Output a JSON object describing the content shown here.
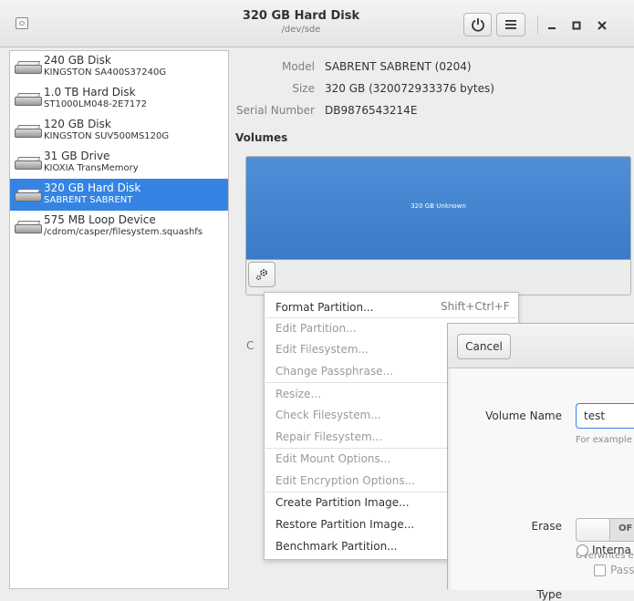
{
  "header": {
    "title": "320 GB Hard Disk",
    "subtitle": "/dev/sde"
  },
  "disks": [
    {
      "name": "240 GB Disk",
      "model": "KINGSTON SA400S37240G",
      "selected": false
    },
    {
      "name": "1.0 TB Hard Disk",
      "model": "ST1000LM048-2E7172",
      "selected": false
    },
    {
      "name": "120 GB Disk",
      "model": "KINGSTON SUV500MS120G",
      "selected": false
    },
    {
      "name": "31 GB Drive",
      "model": "KIOXIA TransMemory",
      "selected": false
    },
    {
      "name": "320 GB Hard Disk",
      "model": "SABRENT SABRENT",
      "selected": true
    },
    {
      "name": "575 MB Loop Device",
      "model": "/cdrom/casper/filesystem.squashfs",
      "selected": false
    }
  ],
  "details": {
    "model_label": "Model",
    "model_value": "SABRENT SABRENT (0204)",
    "size_label": "Size",
    "size_value": "320 GB (320072933376 bytes)",
    "serial_label": "Serial Number",
    "serial_value": "DB9876543214E"
  },
  "volumes": {
    "heading": "Volumes",
    "block_label": "320 GB Unknown",
    "partial_label": "C"
  },
  "context_menu": {
    "shortcut": "Shift+Ctrl+F",
    "items": [
      {
        "label": "Format Partition...",
        "enabled": true
      },
      {
        "label": "Edit Partition...",
        "enabled": false
      },
      {
        "label": "Edit Filesystem...",
        "enabled": false
      },
      {
        "label": "Change Passphrase...",
        "enabled": false
      },
      {
        "label": "Resize...",
        "enabled": false
      },
      {
        "label": "Check Filesystem...",
        "enabled": false
      },
      {
        "label": "Repair Filesystem...",
        "enabled": false
      },
      {
        "label": "Edit Mount Options...",
        "enabled": false
      },
      {
        "label": "Edit Encryption Options...",
        "enabled": false
      },
      {
        "label": "Create Partition Image...",
        "enabled": true
      },
      {
        "label": "Restore Partition Image...",
        "enabled": true
      },
      {
        "label": "Benchmark Partition...",
        "enabled": true
      }
    ]
  },
  "dialog": {
    "cancel_label": "Cancel",
    "volume_name_label": "Volume Name",
    "volume_name_value": "test",
    "volume_name_hint": "For example",
    "erase_label": "Erase",
    "erase_state": "OF",
    "erase_hint": "Overwrites e",
    "type_label": "Type",
    "type_option": "Interna",
    "pass_option": "Pass"
  },
  "icons": {
    "app": "disks-app-icon",
    "power": "power-icon",
    "menu": "hamburger-menu-icon",
    "gear": "gear-icon"
  }
}
